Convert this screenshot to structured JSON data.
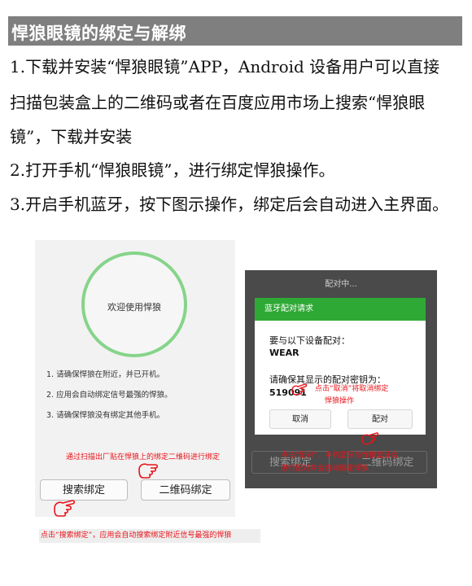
{
  "section_title": "悍狼眼镜的绑定与解绑",
  "paragraphs": {
    "p1_line1": "1.下载并安装“悍狼眼镜”APP，Android 设备用户可以直接",
    "p1_line2": "扫描包装盒上的二维码或者在百度应用市场上搜索“悍狼眼",
    "p1_line3": "镜”，下载并安装",
    "p2": "2.打开手机“悍狼眼镜”，进行绑定悍狼操作。",
    "p3": "3.开启手机蓝牙，按下图示操作，绑定后会自动进入主界面。"
  },
  "left_screen": {
    "welcome": "欢迎使用悍狼",
    "tips": [
      "1. 请确保悍狼在附近，并已开机。",
      "2. 应用会自动绑定信号最强的悍狼。",
      "3. 请确保悍狼没有绑定其他手机。"
    ],
    "qr_note": "通过扫描出厂贴在悍狼上的绑定二维码进行绑定",
    "search_button": "搜索绑定",
    "qr_button": "二维码绑定",
    "bottom_note": "点击“搜索绑定”，应用会自动搜索绑定附近信号最强的悍狼",
    "accent_color": "#86d48a"
  },
  "right_screen": {
    "header": "配对中...",
    "dialog_title": "蓝牙配对请求",
    "pair_prompt": "要与以下设备配对：",
    "device_name": "WEAR",
    "confirm_prompt": "请确保其显示的配对密钥为：",
    "passkey": "519091",
    "cancel_button": "取消",
    "pair_button": "配对",
    "cancel_note_line1": "点击“取消”将取消绑定",
    "cancel_note_line2": "悍狼操作",
    "pair_note_line1": "点击“配对”，手机蓝牙与悍狼蓝牙会",
    "pair_note_line2": "进行配对并会自动绑定悍狼",
    "under_left": "搜索绑定",
    "under_right": "二维码绑定",
    "dialog_color": "#2fa935"
  }
}
